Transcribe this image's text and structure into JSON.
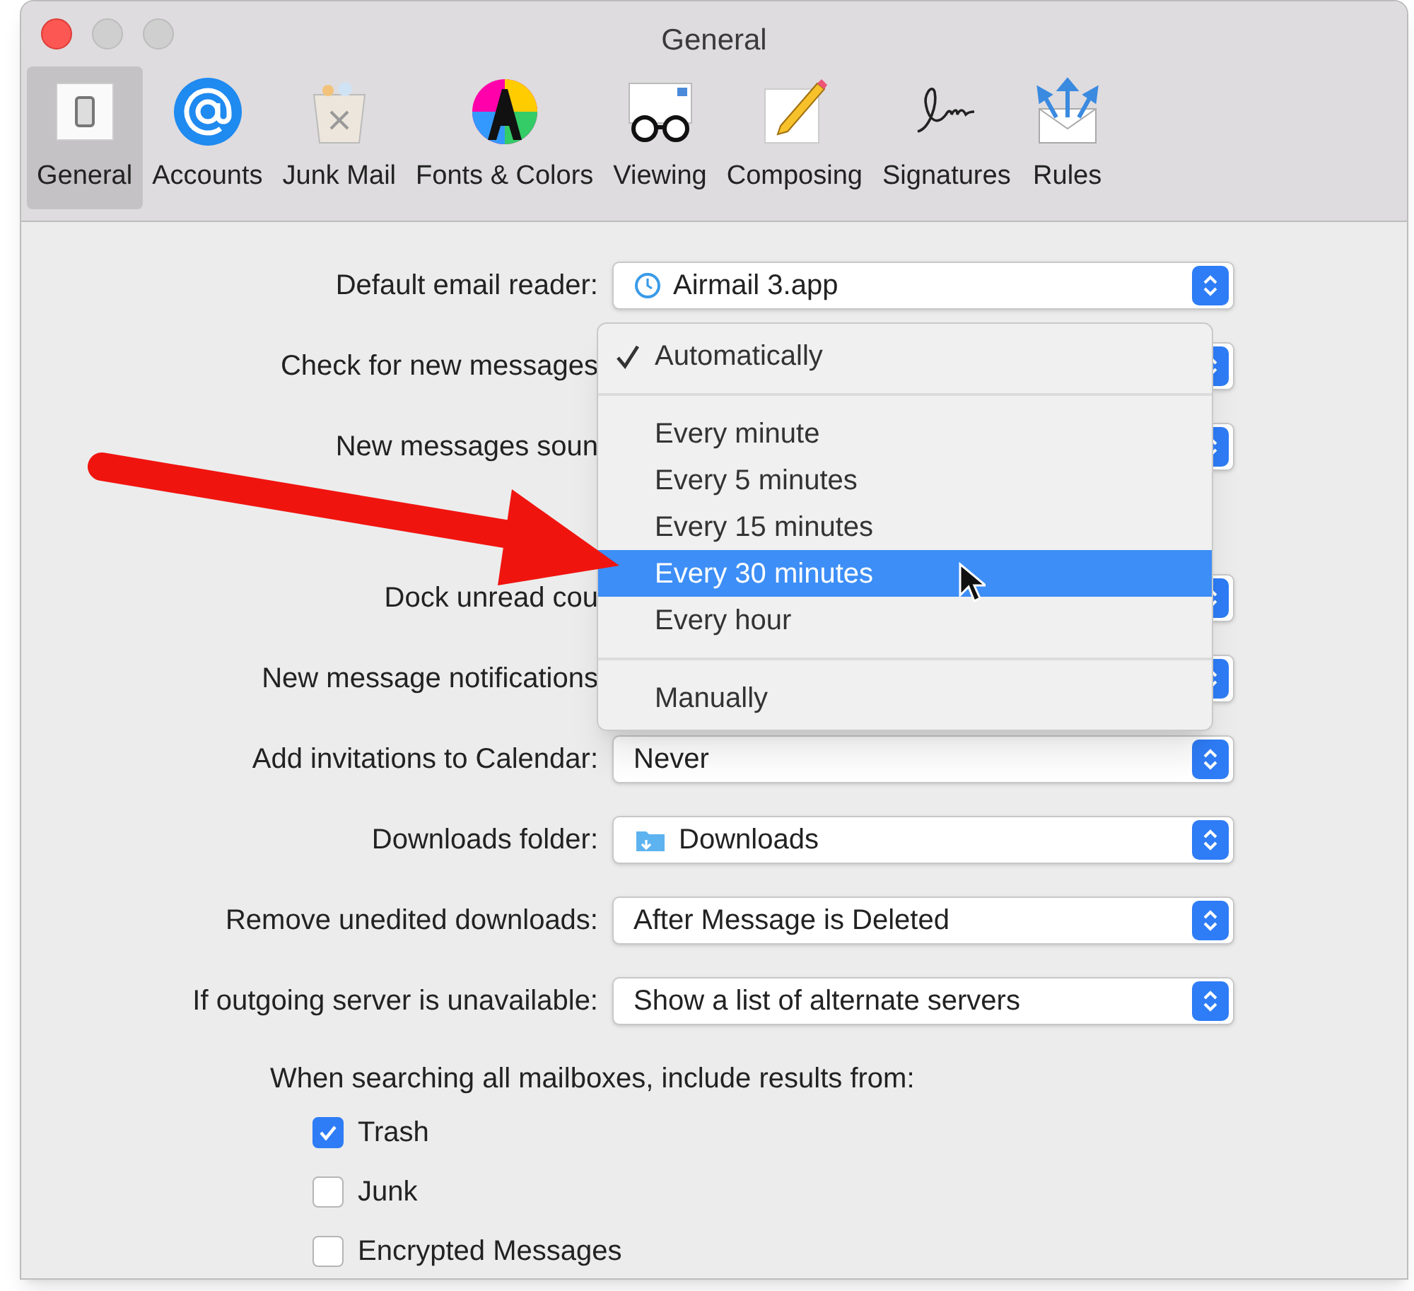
{
  "window": {
    "title": "General"
  },
  "toolbar": [
    {
      "label": "General",
      "selected": true
    },
    {
      "label": "Accounts",
      "selected": false
    },
    {
      "label": "Junk Mail",
      "selected": false
    },
    {
      "label": "Fonts & Colors",
      "selected": false
    },
    {
      "label": "Viewing",
      "selected": false
    },
    {
      "label": "Composing",
      "selected": false
    },
    {
      "label": "Signatures",
      "selected": false
    },
    {
      "label": "Rules",
      "selected": false
    }
  ],
  "settings": [
    {
      "label": "Default email reader:",
      "value": {
        "text": "Airmail 3.app",
        "kind": "app"
      }
    },
    {
      "label": "Check for new messages"
    },
    {
      "label": "New messages soun"
    },
    {
      "label": "Dock unread cou"
    },
    {
      "label": "New message notifications"
    },
    {
      "label": "Add invitations to Calendar:",
      "value": {
        "text": "Never",
        "kind": "plain"
      }
    },
    {
      "label": "Downloads folder:",
      "value": {
        "text": "Downloads",
        "kind": "folder"
      }
    },
    {
      "label": "Remove unedited downloads:",
      "value": {
        "text": "After Message is Deleted",
        "kind": "plain"
      }
    },
    {
      "label": "If outgoing server is unavailable:",
      "value": {
        "text": "Show a list of alternate servers",
        "kind": "plain"
      }
    }
  ],
  "menu": {
    "items": [
      {
        "kind": "item",
        "label": "Automatically",
        "checked": true,
        "selected": false
      },
      {
        "kind": "separator"
      },
      {
        "kind": "item",
        "label": "Every minute",
        "checked": false,
        "selected": false
      },
      {
        "kind": "item",
        "label": "Every 5 minutes",
        "checked": false,
        "selected": false
      },
      {
        "kind": "item",
        "label": "Every 15 minutes",
        "checked": false,
        "selected": false
      },
      {
        "kind": "item",
        "label": "Every 30 minutes",
        "checked": false,
        "selected": true
      },
      {
        "kind": "item",
        "label": "Every hour",
        "checked": false,
        "selected": false
      },
      {
        "kind": "separator"
      },
      {
        "kind": "item",
        "label": "Manually",
        "checked": false,
        "selected": false
      }
    ]
  },
  "search_scope": {
    "label": "When searching all mailboxes, include results from:",
    "options": [
      {
        "label": "Trash",
        "checked": true
      },
      {
        "label": "Junk",
        "checked": false
      },
      {
        "label": "Encrypted Messages",
        "checked": false
      }
    ]
  }
}
